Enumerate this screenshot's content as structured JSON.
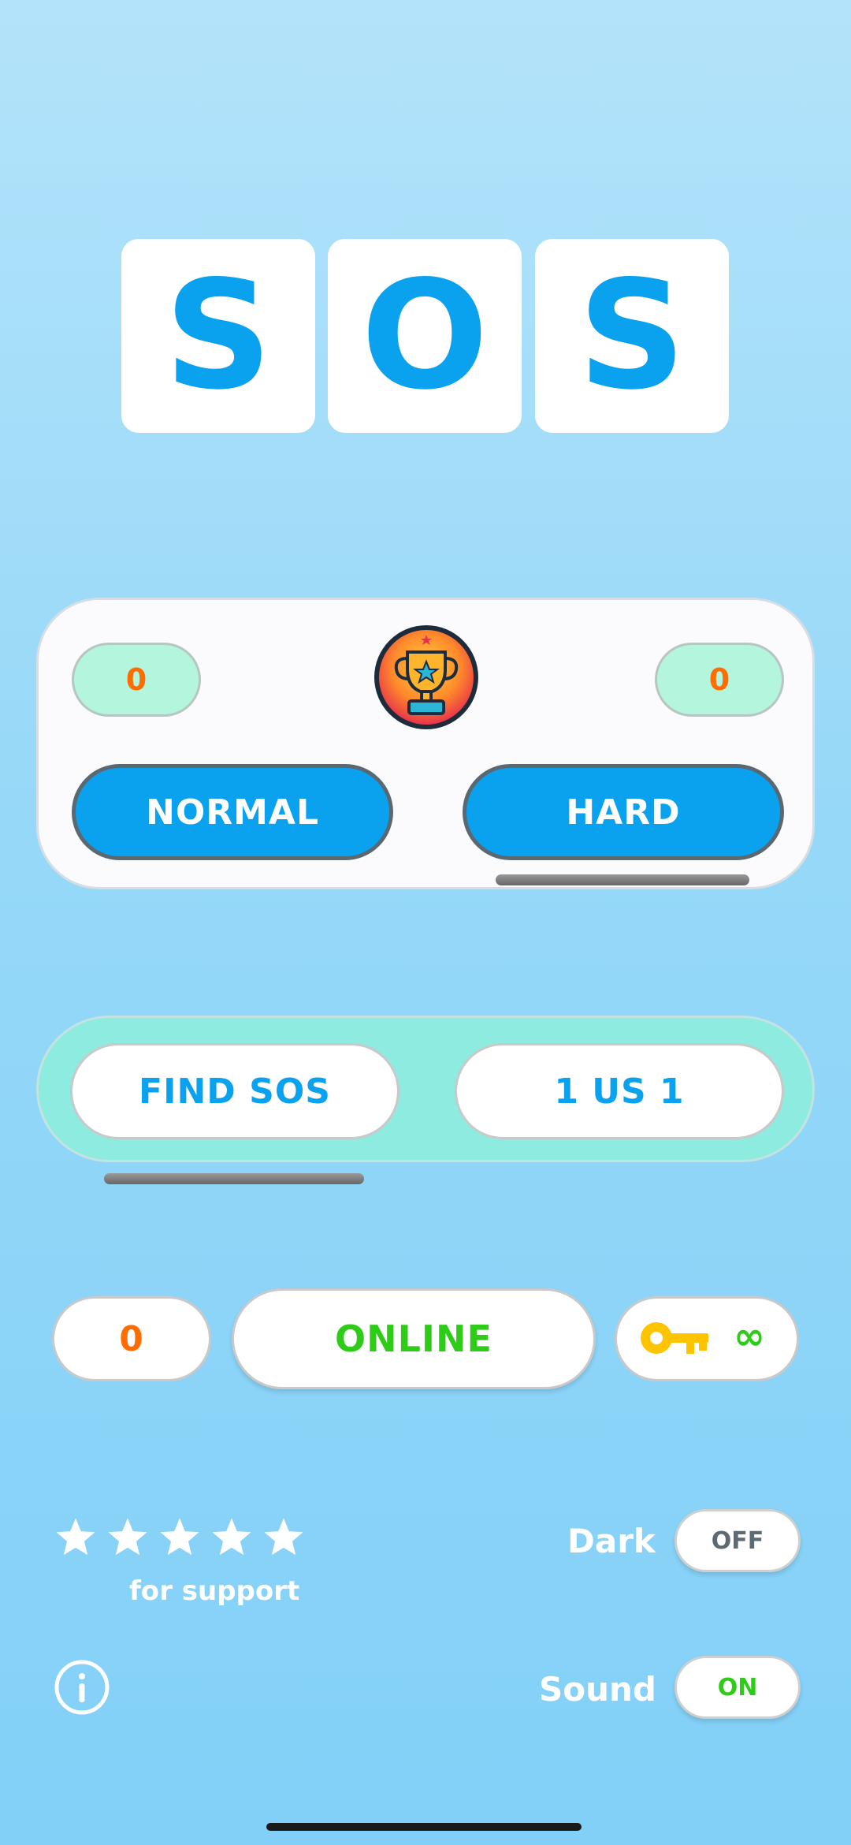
{
  "title_letters": [
    "S",
    "O",
    "S"
  ],
  "score_card": {
    "left_score": "0",
    "right_score": "0",
    "trophy_icon": "trophy-icon",
    "normal_label": "NORMAL",
    "hard_label": "HARD",
    "selected_mode": "HARD"
  },
  "game_types": {
    "find_sos_label": "FIND SOS",
    "one_vs_one_label": "1 US 1",
    "selected": "FIND SOS"
  },
  "online_bar": {
    "count": "0",
    "online_label": "ONLINE",
    "key_icon": "key-icon",
    "keys": "∞"
  },
  "rating": {
    "stars": 5,
    "support_label": "for support"
  },
  "settings": {
    "dark_label": "Dark",
    "dark_value": "OFF",
    "sound_label": "Sound",
    "sound_value": "ON"
  },
  "colors": {
    "accent_blue": "#0aa2ee",
    "score_orange": "#ff6d00",
    "online_green": "#2ecc18",
    "key_yellow": "#ffc400",
    "mint": "#b3f5dd",
    "panel_teal": "#8eebe0"
  }
}
